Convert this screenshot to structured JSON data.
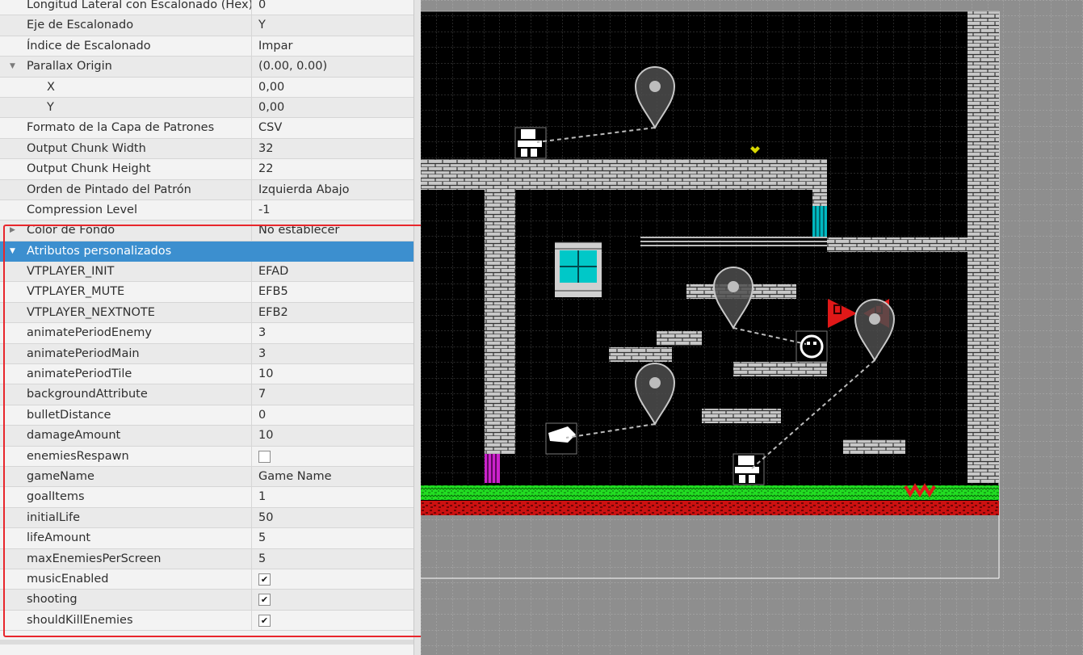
{
  "properties": [
    {
      "key": "Longitud Lateral con Escalonado (Hex)",
      "value": "0",
      "level": 0
    },
    {
      "key": "Eje de Escalonado",
      "value": "Y",
      "level": 0
    },
    {
      "key": "Índice de Escalonado",
      "value": "Impar",
      "level": 0
    },
    {
      "key": "Parallax Origin",
      "value": "(0.00, 0.00)",
      "level": 0,
      "expander": "open"
    },
    {
      "key": "X",
      "value": "0,00",
      "level": 1
    },
    {
      "key": "Y",
      "value": "0,00",
      "level": 1
    },
    {
      "key": "Formato de la Capa de Patrones",
      "value": "CSV",
      "level": 0
    },
    {
      "key": "Output Chunk Width",
      "value": "32",
      "level": 0
    },
    {
      "key": "Output Chunk Height",
      "value": "22",
      "level": 0
    },
    {
      "key": "Orden de Pintado del Patrón",
      "value": "Izquierda Abajo",
      "level": 0
    },
    {
      "key": "Compression Level",
      "value": "-1",
      "level": 0
    },
    {
      "key": "Color de Fondo",
      "value": "No establecer",
      "level": 0,
      "expander": "closed"
    },
    {
      "key": "Atributos personalizados",
      "value": "",
      "level": 0,
      "expander": "open",
      "group": true,
      "selected": true
    },
    {
      "key": "VTPLAYER_INIT",
      "value": "EFAD",
      "level": 0
    },
    {
      "key": "VTPLAYER_MUTE",
      "value": "EFB5",
      "level": 0
    },
    {
      "key": "VTPLAYER_NEXTNOTE",
      "value": "EFB2",
      "level": 0
    },
    {
      "key": "animatePeriodEnemy",
      "value": "3",
      "level": 0
    },
    {
      "key": "animatePeriodMain",
      "value": "3",
      "level": 0
    },
    {
      "key": "animatePeriodTile",
      "value": "10",
      "level": 0
    },
    {
      "key": "backgroundAttribute",
      "value": "7",
      "level": 0
    },
    {
      "key": "bulletDistance",
      "value": "0",
      "level": 0
    },
    {
      "key": "damageAmount",
      "value": "10",
      "level": 0
    },
    {
      "key": "enemiesRespawn",
      "value": "",
      "level": 0,
      "checkbox": false
    },
    {
      "key": "gameName",
      "value": "Game Name",
      "level": 0
    },
    {
      "key": "goalItems",
      "value": "1",
      "level": 0
    },
    {
      "key": "initialLife",
      "value": "50",
      "level": 0
    },
    {
      "key": "lifeAmount",
      "value": "5",
      "level": 0
    },
    {
      "key": "maxEnemiesPerScreen",
      "value": "5",
      "level": 0
    },
    {
      "key": "musicEnabled",
      "value": "",
      "level": 0,
      "checkbox": true
    },
    {
      "key": "shooting",
      "value": "",
      "level": 0,
      "checkbox": true
    },
    {
      "key": "shouldKillEnemies",
      "value": "",
      "level": 0,
      "checkbox": true
    }
  ],
  "icons": {
    "expander_open": "expand-arrow-icon",
    "expander_closed": "collapse-arrow-icon",
    "check": "checkmark-icon",
    "map_marker": "location-pin-icon"
  },
  "colors": {
    "selection": "#3c8fcf",
    "highlight_box": "#e8262c",
    "map_background": "#000000",
    "outside_map": "#8e8e8e",
    "brick": "#c8c8c8",
    "grass": "#22dd22",
    "lava": "#cc1111",
    "cyan_tile": "#00c8c8",
    "magenta_tile": "#cc22cc",
    "enemy_red": "#e01818",
    "collectible_yellow": "#d8d800"
  }
}
